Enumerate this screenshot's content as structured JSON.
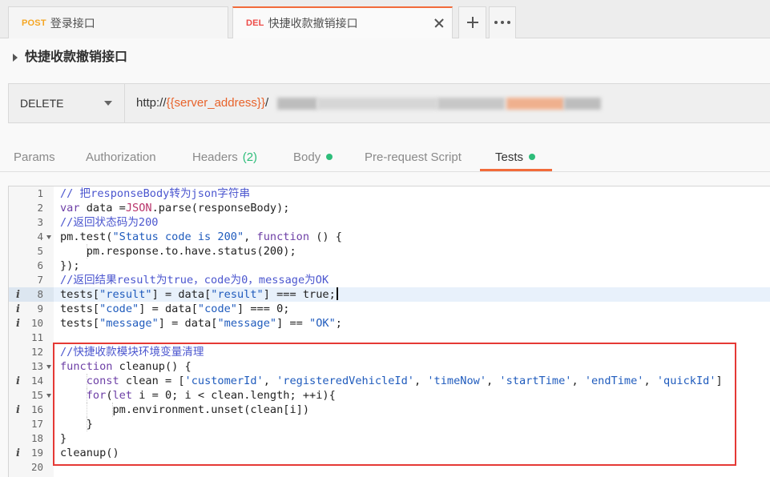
{
  "request_tabs": [
    {
      "method": "POST",
      "name": "登录接口",
      "active": false
    },
    {
      "method": "DEL",
      "name": "快捷收款撤销接口",
      "active": true
    }
  ],
  "request": {
    "title": "快捷收款撤销接口",
    "method": "DELETE",
    "url": {
      "prefix": "http://",
      "variable": "{{server_address}}",
      "path_sep": "/"
    }
  },
  "sub_tabs": [
    {
      "label": "Params"
    },
    {
      "label": "Authorization"
    },
    {
      "label": "Headers",
      "count": "(2)"
    },
    {
      "label": "Body",
      "dot": true
    },
    {
      "label": "Pre-request Script"
    },
    {
      "label": "Tests",
      "dot": true,
      "active": true
    }
  ],
  "icons": {
    "tab_close": "close-icon",
    "new_tab": "plus-icon",
    "more_tabs": "more-horizontal-icon",
    "collapse": "caret-right-icon",
    "method_dropdown": "chevron-down-icon",
    "line_info": "info-icon",
    "fold": "fold-arrow-icon"
  },
  "colors": {
    "accent": "#f26b3a",
    "method_post": "#f5a623",
    "method_del": "#ed4b48",
    "url_variable": "#e8632b",
    "status_dot": "#2ebd7a",
    "headers_count": "#2ebd7a",
    "highlight_box": "#e53935",
    "code_comment": "#4b56cf",
    "code_string": "#1f5bbd",
    "code_keyword": "#6d3fa6",
    "code_builtin": "#b8336a",
    "code_number": "#1a1a1a"
  },
  "editor": {
    "lines": [
      {
        "n": 1,
        "tokens": [
          {
            "t": "// 把responseBody转为json字符串",
            "k": "cmt"
          }
        ]
      },
      {
        "n": 2,
        "tokens": [
          {
            "t": "var",
            "k": "kw"
          },
          {
            "t": " data ="
          },
          {
            "t": "JSON",
            "k": "builtin"
          },
          {
            "t": ".parse(responseBody);"
          }
        ]
      },
      {
        "n": 3,
        "tokens": [
          {
            "t": "//返回状态码为200",
            "k": "cmt"
          }
        ]
      },
      {
        "n": 4,
        "fold": true,
        "tokens": [
          {
            "t": "pm.test("
          },
          {
            "t": "\"Status code is 200\"",
            "k": "str"
          },
          {
            "t": ", "
          },
          {
            "t": "function",
            "k": "kw"
          },
          {
            "t": " () {"
          }
        ]
      },
      {
        "n": 5,
        "tokens": [
          {
            "t": "    "
          },
          {
            "t": "pm.response.to.have.status("
          },
          {
            "t": "200",
            "k": "num"
          },
          {
            "t": ");"
          }
        ]
      },
      {
        "n": 6,
        "tokens": [
          {
            "t": "});"
          }
        ]
      },
      {
        "n": 7,
        "tokens": [
          {
            "t": "//返回结果result为true，code为0，message为OK",
            "k": "cmt"
          }
        ]
      },
      {
        "n": 8,
        "info": true,
        "active": true,
        "tokens": [
          {
            "t": "tests["
          },
          {
            "t": "\"result\"",
            "k": "str"
          },
          {
            "t": "] = data["
          },
          {
            "t": "\"result\"",
            "k": "str"
          },
          {
            "t": "] === "
          },
          {
            "t": "true",
            "k": "atom"
          },
          {
            "t": ";"
          }
        ]
      },
      {
        "n": 9,
        "info": true,
        "tokens": [
          {
            "t": "tests["
          },
          {
            "t": "\"code\"",
            "k": "str"
          },
          {
            "t": "] = data["
          },
          {
            "t": "\"code\"",
            "k": "str"
          },
          {
            "t": "] === "
          },
          {
            "t": "0",
            "k": "num"
          },
          {
            "t": ";"
          }
        ]
      },
      {
        "n": 10,
        "info": true,
        "tokens": [
          {
            "t": "tests["
          },
          {
            "t": "\"message\"",
            "k": "str"
          },
          {
            "t": "] = data["
          },
          {
            "t": "\"message\"",
            "k": "str"
          },
          {
            "t": "] == "
          },
          {
            "t": "\"OK\"",
            "k": "str"
          },
          {
            "t": ";"
          }
        ]
      },
      {
        "n": 11,
        "tokens": []
      },
      {
        "n": 12,
        "tokens": [
          {
            "t": "//快捷收款模块环境变量清理",
            "k": "cmt"
          }
        ]
      },
      {
        "n": 13,
        "fold": true,
        "tokens": [
          {
            "t": "function",
            "k": "kw"
          },
          {
            "t": " cleanup() {"
          }
        ]
      },
      {
        "n": 14,
        "info": true,
        "tokens": [
          {
            "t": "    "
          },
          {
            "t": "const",
            "k": "kw"
          },
          {
            "t": " clean = ["
          },
          {
            "t": "'customerId'",
            "k": "str"
          },
          {
            "t": ", "
          },
          {
            "t": "'registeredVehicleId'",
            "k": "str"
          },
          {
            "t": ", "
          },
          {
            "t": "'timeNow'",
            "k": "str"
          },
          {
            "t": ", "
          },
          {
            "t": "'startTime'",
            "k": "str"
          },
          {
            "t": ", "
          },
          {
            "t": "'endTime'",
            "k": "str"
          },
          {
            "t": ", "
          },
          {
            "t": "'quickId'",
            "k": "str"
          },
          {
            "t": "]"
          }
        ]
      },
      {
        "n": 15,
        "fold": true,
        "tokens": [
          {
            "t": "    "
          },
          {
            "t": "for",
            "k": "kw"
          },
          {
            "t": "("
          },
          {
            "t": "let",
            "k": "kw"
          },
          {
            "t": " i = "
          },
          {
            "t": "0",
            "k": "num"
          },
          {
            "t": "; i < clean.length; ++i){"
          }
        ]
      },
      {
        "n": 16,
        "info": true,
        "tokens": [
          {
            "t": "        "
          },
          {
            "t": "pm.environment.unset(clean[i])"
          }
        ]
      },
      {
        "n": 17,
        "tokens": [
          {
            "t": "    "
          },
          {
            "t": "}"
          }
        ]
      },
      {
        "n": 18,
        "tokens": [
          {
            "t": "}"
          }
        ]
      },
      {
        "n": 19,
        "info": true,
        "tokens": [
          {
            "t": "cleanup()"
          }
        ]
      },
      {
        "n": 20,
        "tokens": []
      }
    ]
  }
}
